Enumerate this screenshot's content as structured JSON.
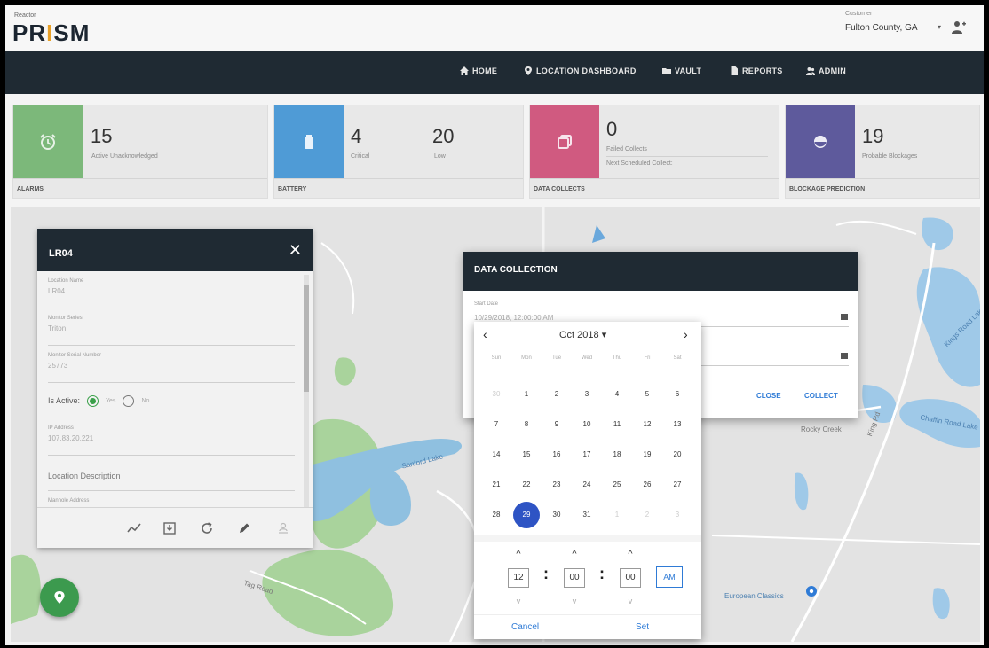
{
  "header": {
    "brand_small": "Reactor",
    "logo_left": "PR",
    "logo_mark": "I",
    "logo_right": "SM",
    "customer_label": "Customer",
    "customer_value": "Fulton County, GA",
    "user_icon": "user-add-icon"
  },
  "nav": {
    "items": [
      {
        "label": "HOME",
        "icon": "home-icon"
      },
      {
        "label": "LOCATION DASHBOARD",
        "icon": "map-pin-icon"
      },
      {
        "label": "VAULT",
        "icon": "folder-icon"
      },
      {
        "label": "REPORTS",
        "icon": "document-icon"
      },
      {
        "label": "ADMIN",
        "icon": "users-icon"
      }
    ]
  },
  "cards": {
    "alarms": {
      "value": "15",
      "label": "Active Unacknowledged",
      "footer": "ALARMS",
      "color": "#7cb87a"
    },
    "battery": {
      "critical_value": "4",
      "critical_label": "Critical",
      "low_value": "20",
      "low_label": "Low",
      "footer": "BATTERY",
      "color": "#4f9bd6"
    },
    "data_collects": {
      "value": "0",
      "failed_label": "Failed Collects",
      "next_label": "Next Scheduled Collect:",
      "footer": "DATA COLLECTS",
      "color": "#d05a80"
    },
    "blockage": {
      "value": "19",
      "label": "Probable Blockages",
      "footer": "BLOCKAGE PREDICTION",
      "color": "#5e5a9c"
    }
  },
  "map": {
    "labels": {
      "kings_road_lake": "Kings Road Lake",
      "chaffin_road_lake": "Chaffin Road Lake",
      "sanford_lake": "Sanford Lake",
      "rocky_creek": "Rocky Creek",
      "king_rd": "King Rd",
      "european_classics": "European Classics",
      "tag_road": "Tag Road"
    }
  },
  "location_panel": {
    "title": "LR04",
    "fields": [
      {
        "label": "Location Name",
        "value": "LR04"
      },
      {
        "label": "Monitor Series",
        "value": "Triton"
      },
      {
        "label": "Monitor Serial Number",
        "value": "25773"
      }
    ],
    "active_label": "Is Active:",
    "active_yes": "Yes",
    "active_no": "No",
    "ip_label": "IP Address",
    "ip_value": "107.83.20.221",
    "description_label": "Location Description",
    "address_label": "Manhole Address"
  },
  "data_collection": {
    "title": "DATA COLLECTION",
    "start_label": "Start Date",
    "start_value": "10/29/2018, 12:00:00 AM",
    "close_label": "CLOSE",
    "collect_label": "COLLECT"
  },
  "date_picker": {
    "month_label": "Oct 2018 ▾",
    "prev": "‹",
    "next": "›",
    "weekdays": [
      "Sun",
      "Mon",
      "Tue",
      "Wed",
      "Thu",
      "Fri",
      "Sat"
    ],
    "weeks": [
      [
        "30",
        "1",
        "2",
        "3",
        "4",
        "5",
        "6"
      ],
      [
        "7",
        "8",
        "9",
        "10",
        "11",
        "12",
        "13"
      ],
      [
        "14",
        "15",
        "16",
        "17",
        "18",
        "19",
        "20"
      ],
      [
        "21",
        "22",
        "23",
        "24",
        "25",
        "26",
        "27"
      ],
      [
        "28",
        "29",
        "30",
        "31",
        "1",
        "2",
        "3"
      ]
    ],
    "selected": "29",
    "hour": "12",
    "minute": "00",
    "second": "00",
    "ampm": "AM",
    "cancel_label": "Cancel",
    "set_label": "Set",
    "accent": "#2e54c4"
  }
}
